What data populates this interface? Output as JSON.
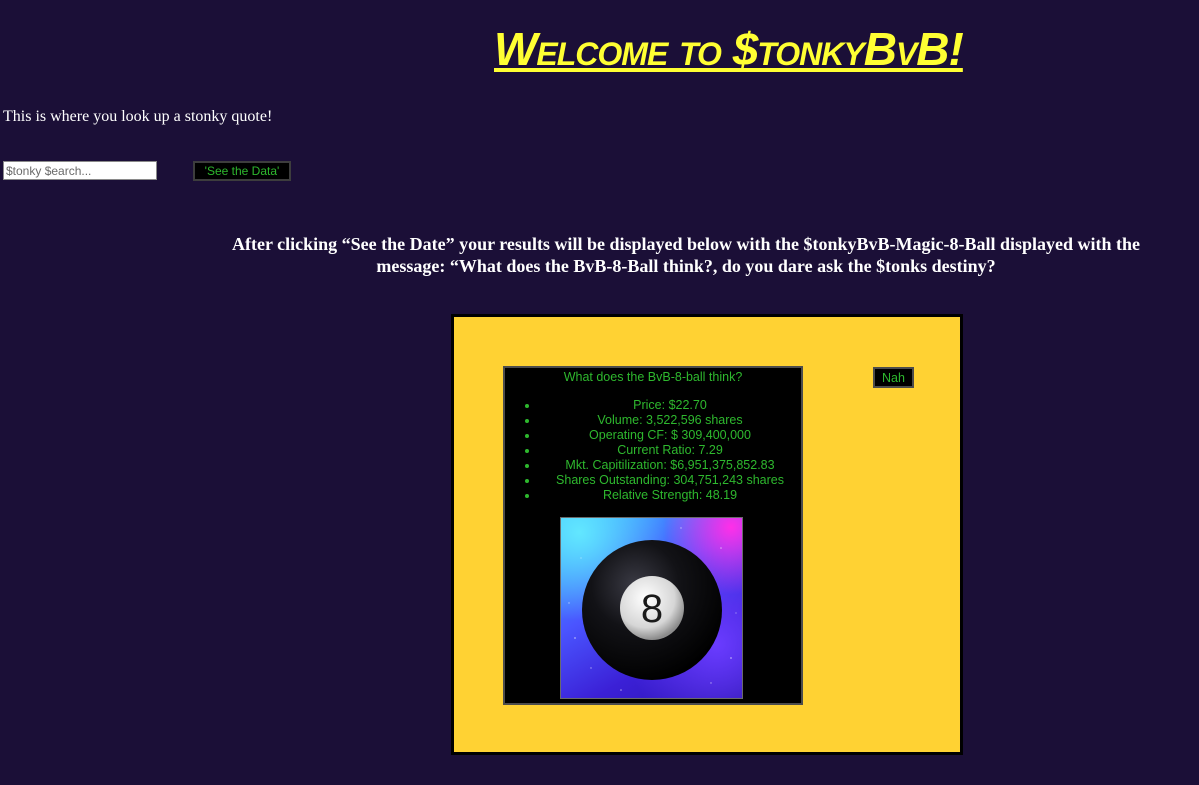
{
  "header": {
    "title": "Welcome to $tonkyBvB!"
  },
  "intro": {
    "text": "This is where you look up a stonky quote!"
  },
  "search": {
    "placeholder": "$tonky $earch...",
    "button_label": "'See the Data'"
  },
  "instructions": {
    "text": "After clicking “See the Date” your results will be displayed below with the $tonkyBvB-Magic-8-Ball displayed with the message: “What does the BvB-8-Ball think?, do you dare ask the $tonks destiny?"
  },
  "results": {
    "card_title": "What does the BvB-8-ball think?",
    "metrics": [
      "Price: $22.70",
      "Volume: 3,522,596 shares",
      "Operating CF: $ 309,400,000",
      "Current Ratio: 7.29",
      "Mkt. Capitilization: $6,951,375,852.83",
      "Shares Outstanding: 304,751,243 shares",
      "Relative Strength: 48.19"
    ],
    "ball_number": "8",
    "dismiss_label": "Nah"
  },
  "colors": {
    "background": "#1b0f37",
    "title": "#ffff33",
    "panel": "#ffd233",
    "card_text": "#2eb82e"
  },
  "icons": {
    "ball_image": "magic-8-ball-image"
  }
}
